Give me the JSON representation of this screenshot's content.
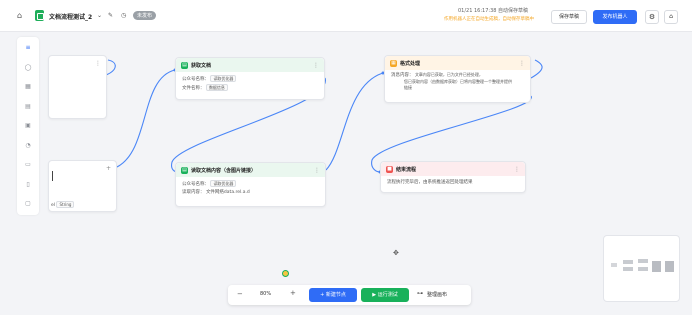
{
  "header": {
    "title": "文档流程测试_2",
    "status_badge": "未发布",
    "timestamp_text": "01/21 16:17:38 自动保存草稿",
    "warning_text": "作用机器人正在自动生成稿，自动保存草稿中",
    "save_draft_label": "保存草稿",
    "publish_label": "发布机器人"
  },
  "nodes": {
    "partial_top": {
      "more": "⋮"
    },
    "partial_bottom": {
      "row_text": "el",
      "tag": "String"
    },
    "get_doc": {
      "title": "获取文档",
      "row1_label": "公众号名称：",
      "row1_value": "读取优化器",
      "row2_label": "文件名称：",
      "row2_value": "数据信息"
    },
    "read_content": {
      "title": "读取文档内容（含图片链接）",
      "row1_label": "公众号名称：",
      "row1_value": "读取优化器",
      "row2_label": "读取内容：",
      "row2_value": "文件网络data.rel.a.d"
    },
    "format": {
      "title": "格式处理",
      "row1_label": "消息内容：",
      "row1_value": "文章内容已获取，已为文件已经处理，",
      "row2_value": "您已获取内容（由数据库获取）已将内容整理一个整理并提供",
      "row3_value": "链接"
    },
    "end": {
      "title": "结束流程",
      "desc": "流程执行完毕后，由系统推送返回处理结果"
    }
  },
  "bottom_toolbar": {
    "zoom_out": "−",
    "zoom_value": "80%",
    "zoom_in": "+",
    "add_node_label": "+ 新建节点",
    "run_label": "▶ 运行测试",
    "arrange_label": "整理画布"
  },
  "colors": {
    "primary": "#2f6cf6",
    "success": "#19b15b",
    "warning": "#f5a623",
    "danger": "#ef5350"
  },
  "icons": [
    "home-icon",
    "doc-icon",
    "chevron-down-icon",
    "edit-icon",
    "history-icon",
    "settings-icon",
    "lock-icon",
    "cursor-icon"
  ]
}
